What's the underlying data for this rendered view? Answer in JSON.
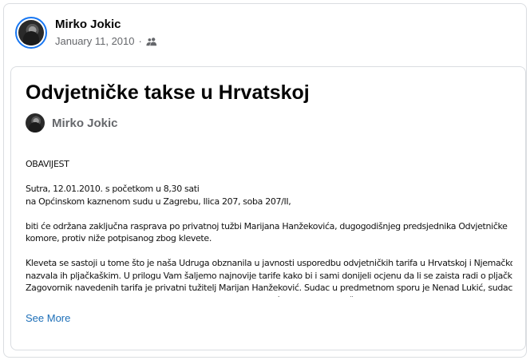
{
  "post": {
    "author": "Mirko Jokic",
    "date": "January 11, 2010",
    "separator": "·",
    "audience_icon": "friends-icon"
  },
  "note": {
    "title": "Odvjetničke takse u Hrvatskoj",
    "author": "Mirko Jokic",
    "paragraphs": [
      [
        "OBAVIJEST"
      ],
      [
        "Sutra, 12.01.2010. s početkom u 8,30 sati",
        "na Općinskom kaznenom sudu u Zagrebu, Ilica 207, soba 207/II,"
      ],
      [
        "biti će održana zaključna rasprava po privatnoj tužbi Marijana Hanžekovića, dugogodišnjeg predsjednika Odvjetničke",
        "komore, protiv niže potpisanog zbog klevete."
      ],
      [
        "Kleveta se sastoji u tome što je naša Udruga obznanila u javnosti usporedbu odvjetničkih tarifa u Hrvatskoj i Njemačkoj i",
        "nazvala ih pljačkaškim. U prilogu Vam šaljemo najnovije tarife kako bi i sami donijeli ocjenu da li se zaista radi o pljački.",
        "Zagovornik navedenih tarifa je privatni tužitelj Marijan Hanžeković. Sudac u predmetnom sporu je Nenad Lukić, sudac koji je",
        "u presudi protiv predsjednika uprave tvrtke Podravka Matanića utvrdio Milu Bošnjaka, Bernarda"
      ]
    ],
    "see_more": "See More"
  }
}
